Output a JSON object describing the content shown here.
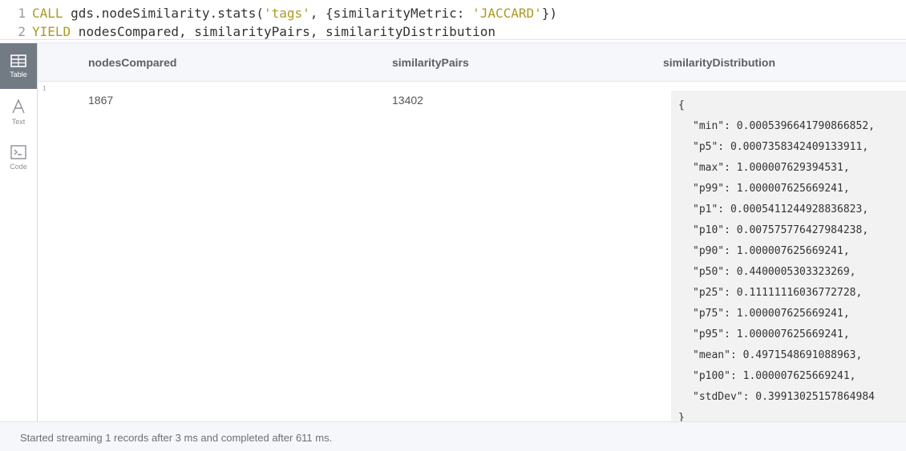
{
  "editor": {
    "lines": [
      {
        "no": "1",
        "t1": "CALL",
        "t2": " gds.nodeSimilarity.stats(",
        "t3": "'tags'",
        "t4": ", {similarityMetric: ",
        "t5": "'JACCARD'",
        "t6": "})"
      },
      {
        "no": "2",
        "t1": "YIELD",
        "t2": " nodesCompared, similarityPairs, similarityDistribution"
      }
    ]
  },
  "views": {
    "table": "Table",
    "text": "Text",
    "code": "Code"
  },
  "table": {
    "headers": [
      "nodesCompared",
      "similarityPairs",
      "similarityDistribution"
    ],
    "row_index": "1",
    "nodesCompared": "1867",
    "similarityPairs": "13402",
    "distribution": {
      "open": "{",
      "close": "}",
      "entries": [
        "\"min\": 0.0005396641790866852,",
        "\"p5\": 0.0007358342409133911,",
        "\"max\": 1.000007629394531,",
        "\"p99\": 1.000007625669241,",
        "\"p1\": 0.0005411244928836823,",
        "\"p10\": 0.007575776427984238,",
        "\"p90\": 1.000007625669241,",
        "\"p50\": 0.4400005303323269,",
        "\"p25\": 0.11111116036772728,",
        "\"p75\": 1.000007625669241,",
        "\"p95\": 1.000007625669241,",
        "\"mean\": 0.4971548691088963,",
        "\"p100\": 1.000007625669241,",
        "\"stdDev\": 0.39913025157864984"
      ]
    }
  },
  "status": "Started streaming 1 records after 3 ms and completed after 611 ms."
}
